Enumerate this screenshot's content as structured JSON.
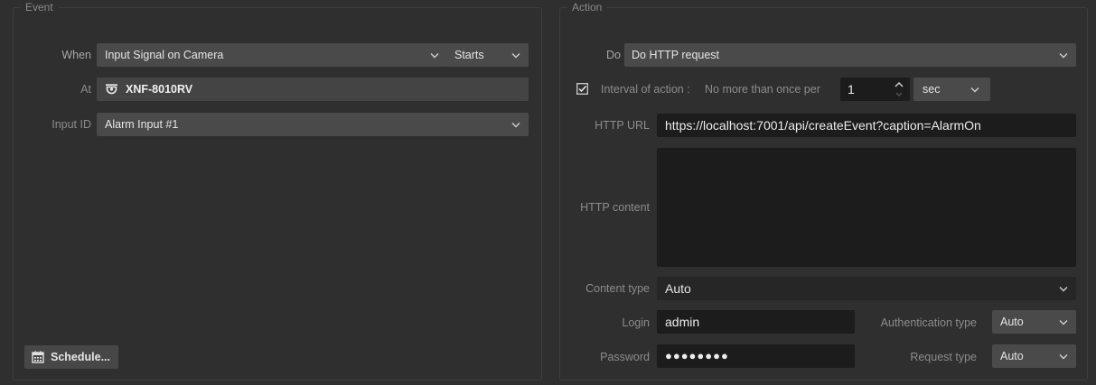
{
  "event_panel": {
    "title": "Event",
    "when": {
      "label": "When",
      "value": "Input Signal on Camera",
      "icon": "chevron-down-icon"
    },
    "starts": {
      "value": "Starts",
      "icon": "chevron-down-icon"
    },
    "at": {
      "label": "At",
      "value": "XNF-8010RV",
      "icon": "camera-icon"
    },
    "input_id": {
      "label": "Input ID",
      "value": "Alarm Input #1",
      "icon": "chevron-down-icon"
    },
    "schedule_button": {
      "label": "Schedule...",
      "icon": "calendar-icon"
    }
  },
  "action_panel": {
    "title": "Action",
    "do": {
      "label": "Do",
      "value": "Do HTTP request",
      "icon": "chevron-down-icon"
    },
    "interval": {
      "checked": true,
      "label": "Interval of action :",
      "prefix": "No more than once per",
      "value": "1",
      "unit": "sec"
    },
    "http_url": {
      "label": "HTTP URL",
      "value": "https://localhost:7001/api/createEvent?caption=AlarmOn"
    },
    "http_content": {
      "label": "HTTP content",
      "value": ""
    },
    "content_type": {
      "label": "Content type",
      "value": "Auto"
    },
    "login": {
      "label": "Login",
      "value": "admin"
    },
    "password": {
      "label": "Password",
      "value": "●●●●●●●●"
    },
    "authentication_type": {
      "label": "Authentication type",
      "value": "Auto"
    },
    "request_type": {
      "label": "Request type",
      "value": "Auto"
    }
  },
  "colors": {
    "background": "#2f2f2f",
    "combo": "#4a4a4a",
    "field": "#1c1c1c",
    "label": "#8c8c8c",
    "text": "#e6e6e6"
  }
}
